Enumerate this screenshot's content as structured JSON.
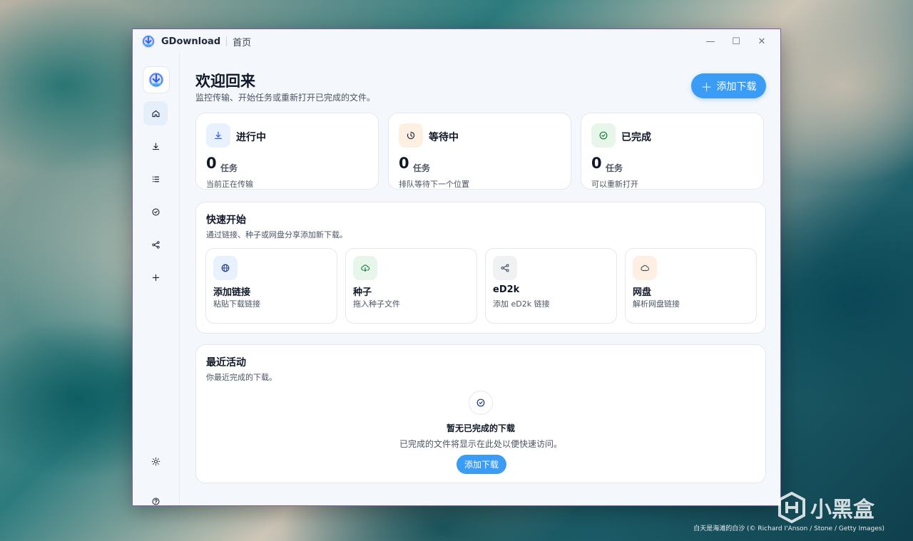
{
  "window": {
    "app_name": "GDownload",
    "page_name": "首页",
    "controls": {
      "minimize": "—",
      "maximize": "☐",
      "close": "✕"
    }
  },
  "sidebar": {
    "items": [
      {
        "id": "home",
        "icon": "home-icon",
        "active": true
      },
      {
        "id": "downloads",
        "icon": "download-icon",
        "active": false
      },
      {
        "id": "queue",
        "icon": "list-icon",
        "active": false
      },
      {
        "id": "completed",
        "icon": "check-circle-icon",
        "active": false
      },
      {
        "id": "share",
        "icon": "share-icon",
        "active": false
      },
      {
        "id": "add",
        "icon": "plus-icon",
        "active": false
      }
    ],
    "bottom": [
      {
        "id": "theme",
        "icon": "sun-icon"
      },
      {
        "id": "help",
        "icon": "help-circle-icon"
      }
    ]
  },
  "header": {
    "title": "欢迎回来",
    "subtitle": "监控传输、开始任务或重新打开已完成的文件。",
    "add_button": "添加下载",
    "add_button_icon": "＋"
  },
  "stats": [
    {
      "title": "进行中",
      "count": "0",
      "unit": "任务",
      "desc": "当前正在传输",
      "icon": "download-icon",
      "color": "#2563eb",
      "bg": "#e8f1fd"
    },
    {
      "title": "等待中",
      "count": "0",
      "unit": "任务",
      "desc": "排队等待下一个位置",
      "icon": "clock-icon",
      "color": "#b45309",
      "bg": "#fdf0e3"
    },
    {
      "title": "已完成",
      "count": "0",
      "unit": "任务",
      "desc": "可以重新打开",
      "icon": "check-circle-icon",
      "color": "#15803d",
      "bg": "#e7f5ea"
    }
  ],
  "quick_start": {
    "title": "快速开始",
    "subtitle": "通过链接、种子或网盘分享添加新下载。",
    "items": [
      {
        "title": "添加链接",
        "desc": "粘贴下载链接",
        "icon": "globe-icon",
        "color": "#2563eb",
        "bg": "#e8f1fd"
      },
      {
        "title": "种子",
        "desc": "拖入种子文件",
        "icon": "cloud-download-icon",
        "color": "#15803d",
        "bg": "#e7f5ea"
      },
      {
        "title": "eD2k",
        "desc": "添加 eD2k 链接",
        "icon": "share-icon",
        "color": "#4b5563",
        "bg": "#f0f1f3"
      },
      {
        "title": "网盘",
        "desc": "解析网盘链接",
        "icon": "cloud-icon",
        "color": "#4b5563",
        "bg": "#fdf0e3"
      }
    ]
  },
  "recent": {
    "title": "最近活动",
    "subtitle": "你最近完成的下载。",
    "empty_title": "暂无已完成的下载",
    "empty_desc": "已完成的文件将显示在此处以便快速访问。",
    "empty_button": "添加下载"
  },
  "watermark": {
    "brand": "小黑盒",
    "credit": "白天是海滩的白沙 (© Richard I'Anson / Stone / Getty Images)"
  }
}
